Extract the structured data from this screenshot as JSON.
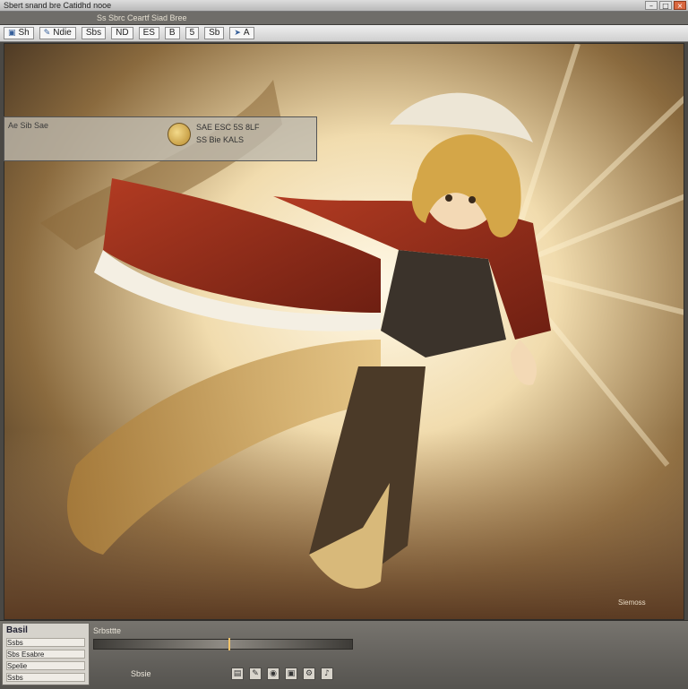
{
  "titlebar": {
    "title": "Sbert snand bre Catidhd nooe"
  },
  "menubar": {
    "doc_title": "Ss Sbrc Ceartf Siad Bree"
  },
  "toolbar": {
    "items": [
      {
        "label": "Sh",
        "icon": "file-icon"
      },
      {
        "label": "Ndie",
        "icon": "tool-icon"
      },
      {
        "label": "Sbs",
        "icon": ""
      },
      {
        "label": "ND",
        "icon": ""
      },
      {
        "label": "ES",
        "icon": ""
      },
      {
        "label": "B",
        "icon": ""
      },
      {
        "label": "5",
        "icon": ""
      },
      {
        "label": "Sb",
        "icon": ""
      },
      {
        "label": "A",
        "icon": "arrow-icon"
      }
    ]
  },
  "overlay": {
    "row1": "Ae  Sib  Sae",
    "meta1": "SAE ESC 5S 8LF",
    "meta2": "SS  Bie  KALS"
  },
  "props": {
    "header": "Basil",
    "rows": [
      "Ssbs",
      "Sbs Esabre",
      "Spelie",
      "Ssbs"
    ]
  },
  "timeline": {
    "label": "Srbsttte",
    "progress": 0.52
  },
  "bottom": {
    "label": "Sbsie"
  },
  "stamp": "Siemoss",
  "colors": {
    "accent": "#f2c46b",
    "cape": "#9c2f1d",
    "sky_glow": "#fff2d4"
  }
}
